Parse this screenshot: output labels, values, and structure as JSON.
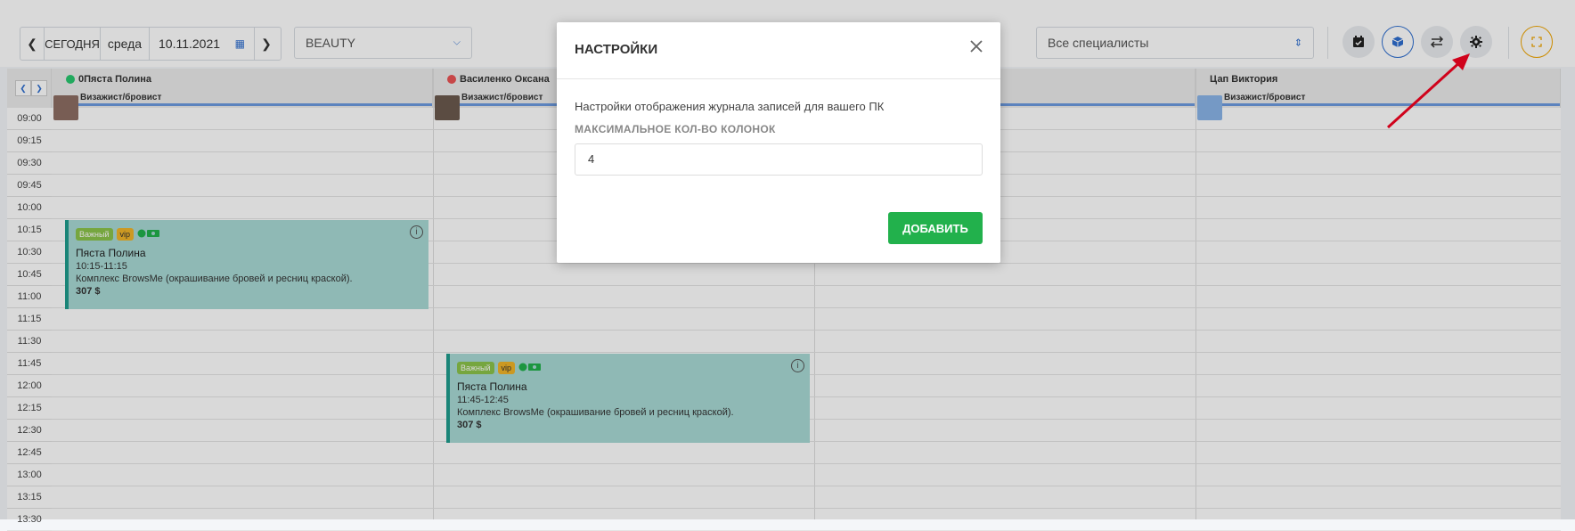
{
  "toolbar": {
    "today": "СЕГОДНЯ",
    "weekday": "среда",
    "date": "10.11.2021",
    "salon": "BEAUTY",
    "specialists": "Все специалисты"
  },
  "columns": [
    {
      "name": "0Пяста Полина",
      "role": "Визажист/бровист",
      "dot_color": "#28c76f"
    },
    {
      "name": "Василенко Оксана",
      "role": "Визажист/бровист",
      "dot_color": "#ea5455"
    },
    {
      "name": "",
      "role": ""
    },
    {
      "name": "Цап Виктория",
      "role": "Визажист/бровист"
    }
  ],
  "times": [
    "09:00",
    "09:15",
    "09:30",
    "09:45",
    "10:00",
    "10:15",
    "10:30",
    "10:45",
    "11:00",
    "11:15",
    "11:30",
    "11:45",
    "12:00",
    "12:15",
    "12:30",
    "12:45",
    "13:00",
    "13:15",
    "13:30"
  ],
  "appointments": [
    {
      "badge_important": "Важный",
      "badge_vip": "vip",
      "client": "Пяста Полина",
      "time": "10:15-11:15",
      "service": "Комплекс BrowsMe (окрашивание бровей и ресниц краской).",
      "price": "307 $"
    },
    {
      "badge_important": "Важный",
      "badge_vip": "vip",
      "client": "Пяста Полина",
      "time": "11:45-12:45",
      "service": "Комплекс BrowsMe (окрашивание бровей и ресниц краской).",
      "price": "307 $"
    }
  ],
  "modal": {
    "title": "НАСТРОЙКИ",
    "description": "Настройки отображения журнала записей для вашего ПК",
    "field_label": "МАКСИМАЛЬНОЕ КОЛ-ВО КОЛОНОК",
    "field_value": "4",
    "submit": "ДОБАВИТЬ"
  },
  "colors": {
    "accent": "#2e6ecf",
    "appointment": "#a9dad5",
    "submit": "#22b14c",
    "annotation": "#d0021b"
  }
}
